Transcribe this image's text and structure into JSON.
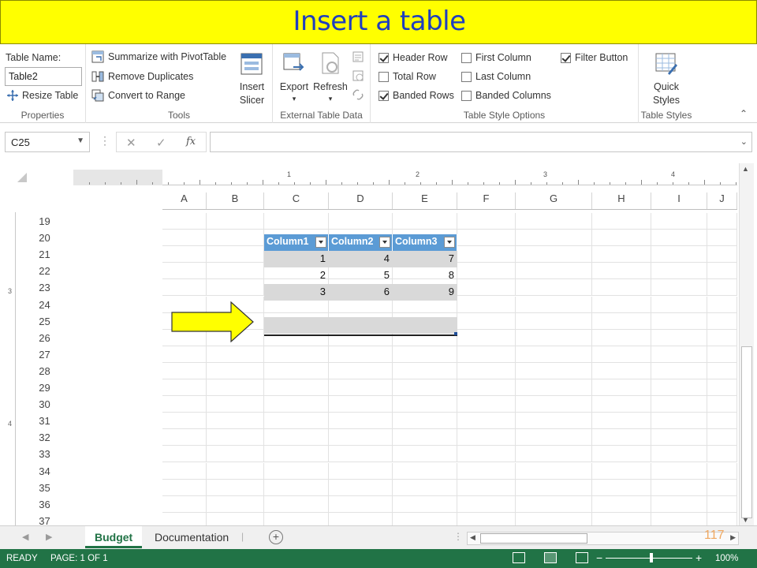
{
  "slide_title": "Insert a table",
  "ribbon": {
    "properties": {
      "table_name_label": "Table Name:",
      "table_name_value": "Table2",
      "resize_table": "Resize Table",
      "group_label": "Properties"
    },
    "tools": {
      "summarize_pivot": "Summarize with PivotTable",
      "remove_duplicates": "Remove Duplicates",
      "convert_to_range": "Convert to Range",
      "insert_slicer_line1": "Insert",
      "insert_slicer_line2": "Slicer",
      "group_label": "Tools"
    },
    "external": {
      "export": "Export",
      "refresh": "Refresh",
      "group_label": "External Table Data"
    },
    "style_options": {
      "header_row": {
        "label": "Header Row",
        "checked": true
      },
      "total_row": {
        "label": "Total Row",
        "checked": false
      },
      "banded_rows": {
        "label": "Banded Rows",
        "checked": true
      },
      "first_column": {
        "label": "First Column",
        "checked": false
      },
      "last_column": {
        "label": "Last Column",
        "checked": false
      },
      "banded_columns": {
        "label": "Banded Columns",
        "checked": false
      },
      "filter_button": {
        "label": "Filter Button",
        "checked": true
      },
      "group_label": "Table Style Options"
    },
    "table_styles": {
      "quick_styles_line1": "Quick",
      "quick_styles_line2": "Styles",
      "group_label": "Table Styles"
    }
  },
  "formula_bar": {
    "name_box": "C25",
    "fx_label": "fx",
    "formula": ""
  },
  "ruler_marks": [
    "1",
    "2",
    "3",
    "4"
  ],
  "left_ruler_marks": [
    "3",
    "4"
  ],
  "columns": [
    "A",
    "B",
    "C",
    "D",
    "E",
    "F",
    "G",
    "H",
    "I",
    "J"
  ],
  "rows": [
    "19",
    "20",
    "21",
    "22",
    "23",
    "24",
    "25",
    "26",
    "27",
    "28",
    "29",
    "30",
    "31",
    "32",
    "33",
    "34",
    "35",
    "36",
    "37"
  ],
  "table": {
    "headers": [
      "Column1",
      "Column2",
      "Column3"
    ],
    "data": [
      [
        "1",
        "4",
        "7"
      ],
      [
        "2",
        "5",
        "8"
      ],
      [
        "3",
        "6",
        "9"
      ],
      [
        "",
        "",
        ""
      ],
      [
        "",
        "",
        ""
      ]
    ]
  },
  "sheet_tabs": [
    "Budget",
    "Documentation"
  ],
  "active_tab": "Budget",
  "slide_number": "117",
  "status": {
    "ready": "READY",
    "page": "PAGE: 1 OF 1",
    "zoom": "100%"
  },
  "colors": {
    "banner": "#ffff00",
    "banner_text": "#1f3fbf",
    "table_header": "#5b9bd5",
    "band": "#d9d9d9",
    "status_bar": "#217346",
    "arrow": "#ffff00"
  }
}
